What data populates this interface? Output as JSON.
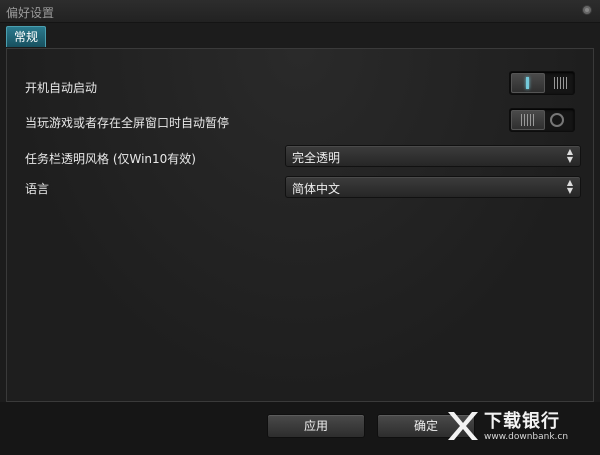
{
  "window": {
    "title": "偏好设置"
  },
  "tabs": [
    {
      "label": "常规",
      "active": true
    }
  ],
  "settings": {
    "autostart": {
      "label": "开机自动启动",
      "state": "on"
    },
    "pause_fullscreen": {
      "label": "当玩游戏或者存在全屏窗口时自动暂停",
      "state": "off"
    },
    "taskbar_style": {
      "label": "任务栏透明风格 (仅Win10有效)",
      "value": "完全透明"
    },
    "language": {
      "label": "语言",
      "value": "简体中文"
    }
  },
  "buttons": {
    "apply": "应用",
    "ok": "确定"
  },
  "watermark": {
    "main": "下载银行",
    "sub": "www.downbank.cn"
  },
  "colors": {
    "accent": "#2b7a8d",
    "toggle_on": "#74c9da",
    "background": "#1c1c1c"
  }
}
